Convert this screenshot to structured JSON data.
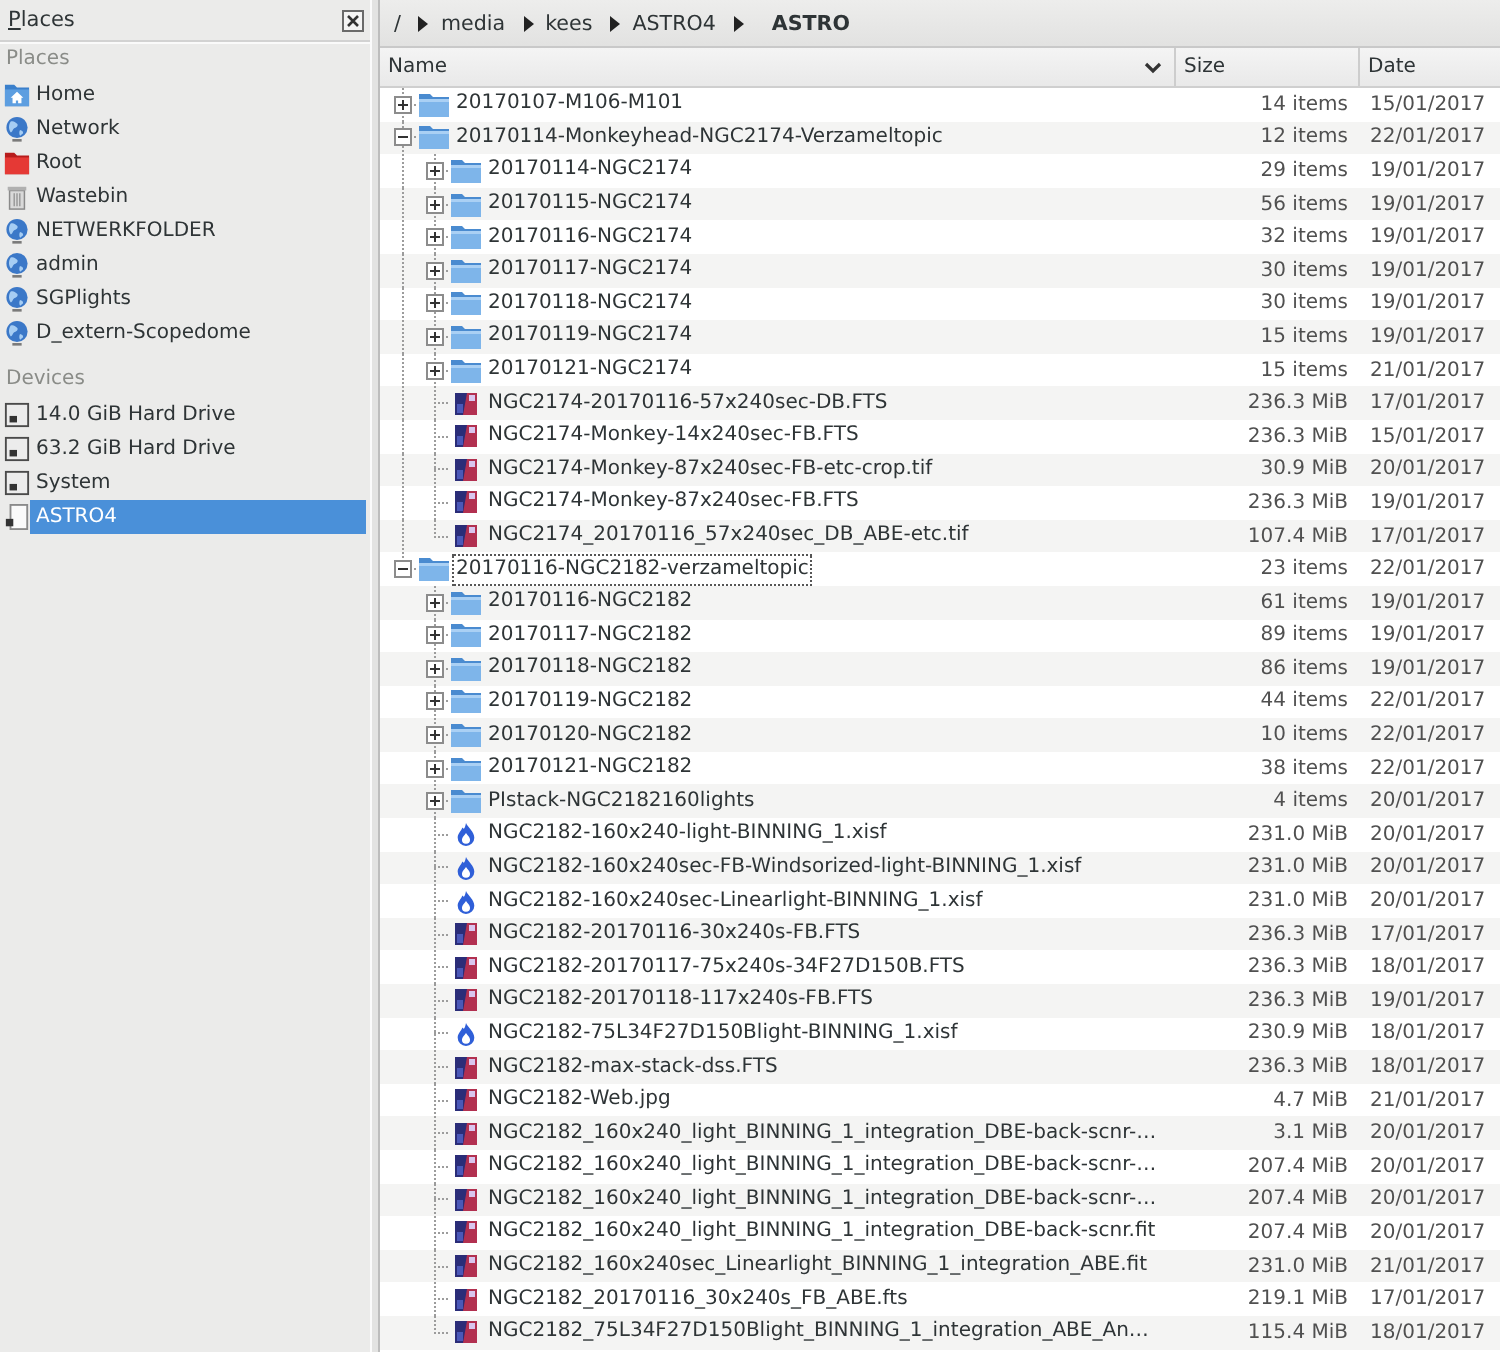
{
  "places_panel": {
    "title": "Places",
    "sections": [
      {
        "heading": "Places",
        "items": [
          {
            "label": "Home",
            "kind": "home",
            "selected": false
          },
          {
            "label": "Network",
            "kind": "network",
            "selected": false
          },
          {
            "label": "Root",
            "kind": "root",
            "selected": false
          },
          {
            "label": "Wastebin",
            "kind": "trash",
            "selected": false
          },
          {
            "label": "NETWERKFOLDER",
            "kind": "network",
            "selected": false
          },
          {
            "label": "admin",
            "kind": "network",
            "selected": false
          },
          {
            "label": "SGPlights",
            "kind": "network",
            "selected": false
          },
          {
            "label": "D_extern-Scopedome",
            "kind": "network",
            "selected": false
          }
        ]
      },
      {
        "heading": "Devices",
        "items": [
          {
            "label": "14.0 GiB Hard Drive",
            "kind": "drive",
            "selected": false
          },
          {
            "label": "63.2 GiB Hard Drive",
            "kind": "drive",
            "selected": false
          },
          {
            "label": "System",
            "kind": "drive",
            "selected": false
          },
          {
            "label": "ASTRO4",
            "kind": "removable",
            "selected": true
          }
        ]
      }
    ]
  },
  "path_bar": {
    "segments": [
      {
        "label": "/",
        "selected": false
      },
      {
        "label": "media",
        "selected": false
      },
      {
        "label": "kees",
        "selected": false
      },
      {
        "label": "ASTRO4",
        "selected": false
      },
      {
        "label": "ASTRO",
        "selected": true
      }
    ]
  },
  "file_list": {
    "columns": [
      {
        "label": "Name",
        "sorted": true
      },
      {
        "label": "Size",
        "sorted": false
      },
      {
        "label": "Date",
        "sorted": false
      }
    ],
    "rows": [
      {
        "name": "20170107-M106-M101",
        "kind": "folder",
        "expanded": false,
        "focused": false,
        "size": "14 items",
        "date": "15/01/2017"
      },
      {
        "name": "20170114-Monkeyhead-NGC2174-Verzameltopic",
        "kind": "folder",
        "expanded": true,
        "focused": false,
        "size": "12 items",
        "date": "22/01/2017",
        "children": [
          {
            "name": "20170114-NGC2174",
            "kind": "folder",
            "expanded": false,
            "size": "29 items",
            "date": "19/01/2017"
          },
          {
            "name": "20170115-NGC2174",
            "kind": "folder",
            "expanded": false,
            "size": "56 items",
            "date": "19/01/2017"
          },
          {
            "name": "20170116-NGC2174",
            "kind": "folder",
            "expanded": false,
            "size": "32 items",
            "date": "19/01/2017"
          },
          {
            "name": "20170117-NGC2174",
            "kind": "folder",
            "expanded": false,
            "size": "30 items",
            "date": "19/01/2017"
          },
          {
            "name": "20170118-NGC2174",
            "kind": "folder",
            "expanded": false,
            "size": "30 items",
            "date": "19/01/2017"
          },
          {
            "name": "20170119-NGC2174",
            "kind": "folder",
            "expanded": false,
            "size": "15 items",
            "date": "19/01/2017"
          },
          {
            "name": "20170121-NGC2174",
            "kind": "folder",
            "expanded": false,
            "size": "15 items",
            "date": "21/01/2017"
          },
          {
            "name": "NGC2174-20170116-57x240sec-DB.FTS",
            "kind": "image",
            "size": "236.3 MiB",
            "date": "17/01/2017"
          },
          {
            "name": "NGC2174-Monkey-14x240sec-FB.FTS",
            "kind": "image",
            "size": "236.3 MiB",
            "date": "15/01/2017"
          },
          {
            "name": "NGC2174-Monkey-87x240sec-FB-etc-crop.tif",
            "kind": "image",
            "size": "30.9 MiB",
            "date": "20/01/2017"
          },
          {
            "name": "NGC2174-Monkey-87x240sec-FB.FTS",
            "kind": "image",
            "size": "236.3 MiB",
            "date": "19/01/2017"
          },
          {
            "name": "NGC2174_20170116_57x240sec_DB_ABE-etc.tif",
            "kind": "image",
            "size": "107.4 MiB",
            "date": "17/01/2017"
          }
        ]
      },
      {
        "name": "20170116-NGC2182-verzameltopic",
        "kind": "folder",
        "expanded": true,
        "focused": true,
        "size": "23 items",
        "date": "22/01/2017",
        "children": [
          {
            "name": "20170116-NGC2182",
            "kind": "folder",
            "expanded": false,
            "size": "61 items",
            "date": "19/01/2017"
          },
          {
            "name": "20170117-NGC2182",
            "kind": "folder",
            "expanded": false,
            "size": "89 items",
            "date": "19/01/2017"
          },
          {
            "name": "20170118-NGC2182",
            "kind": "folder",
            "expanded": false,
            "size": "86 items",
            "date": "19/01/2017"
          },
          {
            "name": "20170119-NGC2182",
            "kind": "folder",
            "expanded": false,
            "size": "44 items",
            "date": "22/01/2017"
          },
          {
            "name": "20170120-NGC2182",
            "kind": "folder",
            "expanded": false,
            "size": "10 items",
            "date": "22/01/2017"
          },
          {
            "name": "20170121-NGC2182",
            "kind": "folder",
            "expanded": false,
            "size": "38 items",
            "date": "22/01/2017"
          },
          {
            "name": "PIstack-NGC2182160lights",
            "kind": "folder",
            "expanded": false,
            "size": "4 items",
            "date": "20/01/2017"
          },
          {
            "name": "NGC2182-160x240-light-BINNING_1.xisf",
            "kind": "xisf",
            "size": "231.0 MiB",
            "date": "20/01/2017"
          },
          {
            "name": "NGC2182-160x240sec-FB-Windsorized-light-BINNING_1.xisf",
            "kind": "xisf",
            "size": "231.0 MiB",
            "date": "20/01/2017"
          },
          {
            "name": "NGC2182-160x240sec-Linearlight-BINNING_1.xisf",
            "kind": "xisf",
            "size": "231.0 MiB",
            "date": "20/01/2017"
          },
          {
            "name": "NGC2182-20170116-30x240s-FB.FTS",
            "kind": "image",
            "size": "236.3 MiB",
            "date": "17/01/2017"
          },
          {
            "name": "NGC2182-20170117-75x240s-34F27D150B.FTS",
            "kind": "image",
            "size": "236.3 MiB",
            "date": "18/01/2017"
          },
          {
            "name": "NGC2182-20170118-117x240s-FB.FTS",
            "kind": "image",
            "size": "236.3 MiB",
            "date": "19/01/2017"
          },
          {
            "name": "NGC2182-75L34F27D150Blight-BINNING_1.xisf",
            "kind": "xisf",
            "size": "230.9 MiB",
            "date": "18/01/2017"
          },
          {
            "name": "NGC2182-max-stack-dss.FTS",
            "kind": "image",
            "size": "236.3 MiB",
            "date": "18/01/2017"
          },
          {
            "name": "NGC2182-Web.jpg",
            "kind": "image",
            "size": "4.7 MiB",
            "date": "21/01/2017"
          },
          {
            "name": "NGC2182_160x240_light_BINNING_1_integration_DBE-back-scnr-…",
            "kind": "image",
            "size": "3.1 MiB",
            "date": "20/01/2017"
          },
          {
            "name": "NGC2182_160x240_light_BINNING_1_integration_DBE-back-scnr-…",
            "kind": "image",
            "size": "207.4 MiB",
            "date": "20/01/2017"
          },
          {
            "name": "NGC2182_160x240_light_BINNING_1_integration_DBE-back-scnr-…",
            "kind": "image",
            "size": "207.4 MiB",
            "date": "20/01/2017"
          },
          {
            "name": "NGC2182_160x240_light_BINNING_1_integration_DBE-back-scnr.fit",
            "kind": "image",
            "size": "207.4 MiB",
            "date": "20/01/2017"
          },
          {
            "name": "NGC2182_160x240sec_Linearlight_BINNING_1_integration_ABE.fit",
            "kind": "image",
            "size": "231.0 MiB",
            "date": "21/01/2017"
          },
          {
            "name": "NGC2182_20170116_30x240s_FB_ABE.fts",
            "kind": "image",
            "size": "219.1 MiB",
            "date": "17/01/2017"
          },
          {
            "name": "NGC2182_75L34F27D150Blight_BINNING_1_integration_ABE_An…",
            "kind": "image",
            "size": "115.4 MiB",
            "date": "18/01/2017"
          }
        ]
      }
    ]
  }
}
